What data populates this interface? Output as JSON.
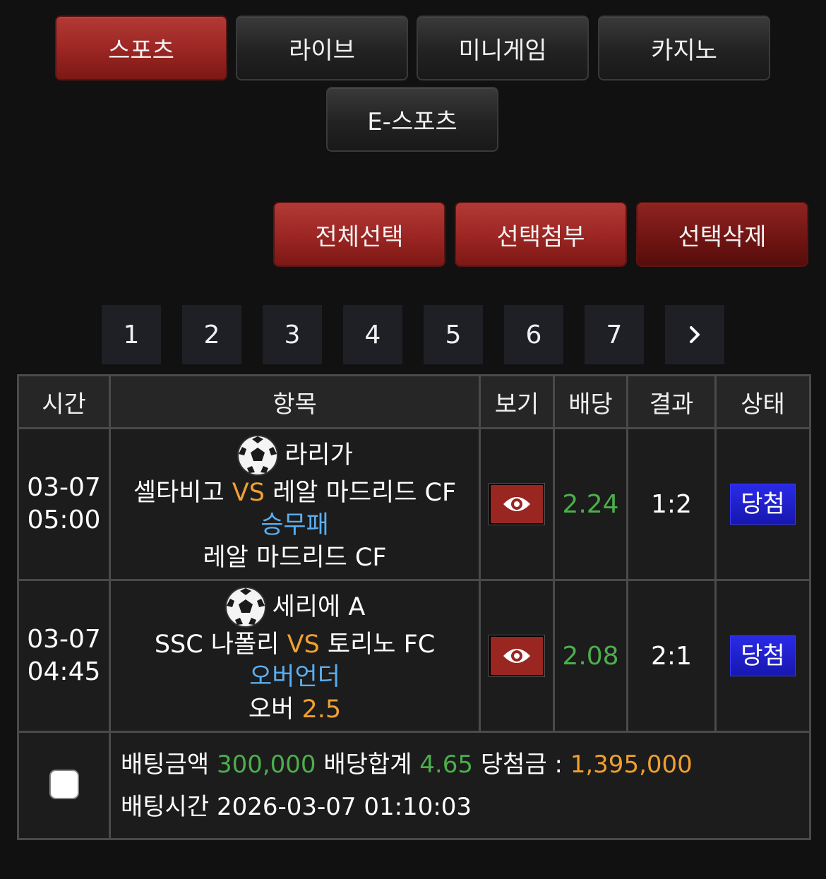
{
  "top_tabs": [
    {
      "label": "스포츠",
      "active": true
    },
    {
      "label": "라이브",
      "active": false
    },
    {
      "label": "미니게임",
      "active": false
    },
    {
      "label": "카지노",
      "active": false
    },
    {
      "label": "E-스포츠",
      "active": false
    }
  ],
  "actions": {
    "select_all": "전체선택",
    "attach_selected": "선택첨부",
    "delete_selected": "선택삭제"
  },
  "pagination": {
    "pages": [
      "1",
      "2",
      "3",
      "4",
      "5",
      "6",
      "7"
    ],
    "next_icon": "chevron-right-icon"
  },
  "table": {
    "headers": [
      "시간",
      "항목",
      "보기",
      "배당",
      "결과",
      "상태"
    ],
    "rows": [
      {
        "date": "03-07",
        "time": "05:00",
        "league_icon": "soccer-ball-icon",
        "league": "라리가",
        "home": "셀타비고",
        "vs": "VS",
        "away": "레알 마드리드 CF",
        "market": "승무패",
        "pick": "레알 마드리드 CF",
        "pick_value": "",
        "odds": "2.24",
        "result": "1:2",
        "status": "당첨"
      },
      {
        "date": "03-07",
        "time": "04:45",
        "league_icon": "soccer-ball-icon",
        "league": "세리에 A",
        "home": "SSC 나폴리",
        "vs": "VS",
        "away": "토리노 FC",
        "market": "오버언더",
        "pick": "오버",
        "pick_value": "2.5",
        "odds": "2.08",
        "result": "2:1",
        "status": "당첨"
      }
    ]
  },
  "summary": {
    "bet_amount_label": "배팅금액",
    "bet_amount": "300,000",
    "total_odds_label": "배당합계",
    "total_odds": "4.65",
    "win_amount_label": "당첨금 :",
    "win_amount": "1,395,000",
    "bet_time_label": "배팅시간",
    "bet_time": "2026-03-07 01:10:03"
  },
  "colors": {
    "active_red": "#9a2522",
    "odds_green": "#4cae4c",
    "vs_orange": "#f0a030",
    "market_blue": "#5aaef0",
    "status_blue": "#1f1fcf"
  }
}
